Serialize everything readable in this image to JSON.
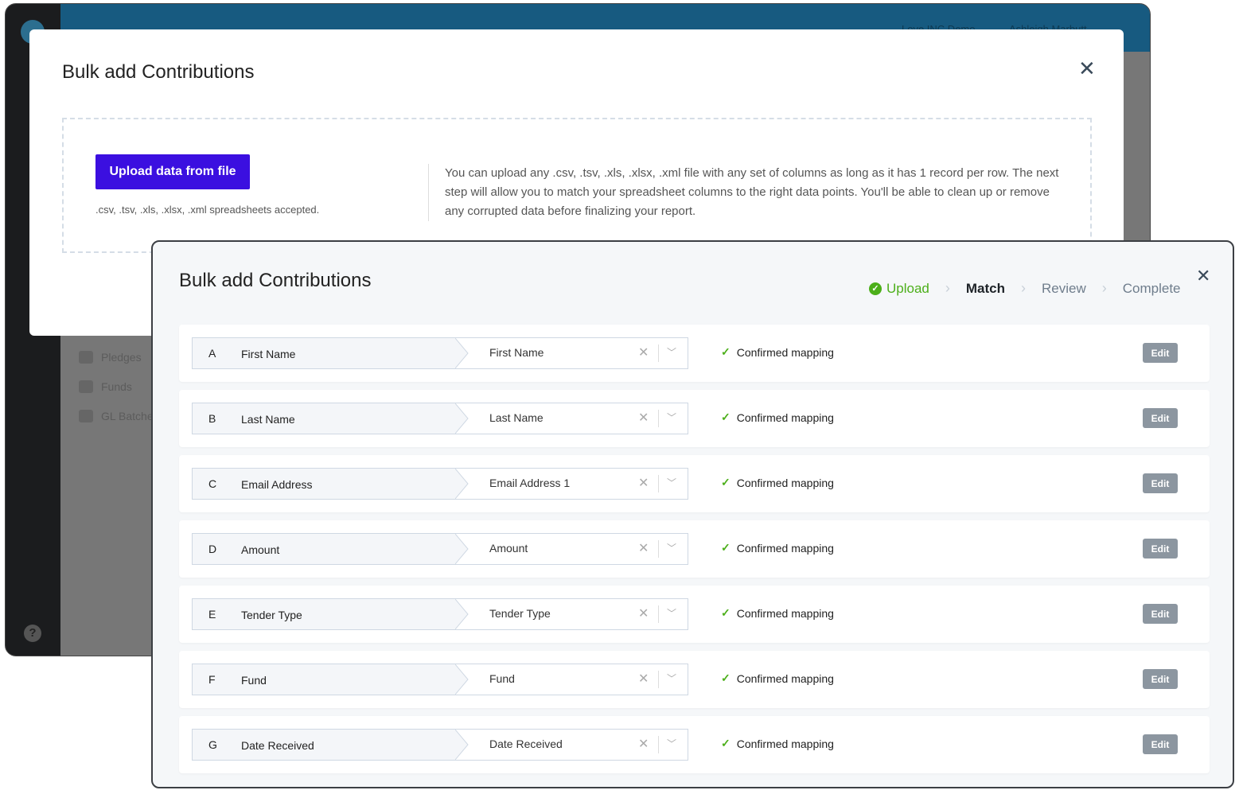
{
  "bg_app": {
    "org": "Love INC Demo",
    "user": "Ashleigh Marbutt",
    "nav": [
      {
        "label": "Pledges"
      },
      {
        "label": "Funds"
      },
      {
        "label": "GL Batches"
      }
    ],
    "help": "?"
  },
  "upload_modal": {
    "title": "Bulk add Contributions",
    "upload_button": "Upload data from file",
    "accepted": ".csv, .tsv, .xls, .xlsx, .xml spreadsheets accepted.",
    "description": "You can upload any .csv, .tsv, .xls, .xlsx, .xml file with any set of columns as long as it has 1 record per row. The next step will allow you to match your spreadsheet columns to the right data points. You'll be able to clean up or remove any corrupted data before finalizing your report."
  },
  "match_modal": {
    "title": "Bulk add Contributions",
    "steps": {
      "upload": "Upload",
      "match": "Match",
      "review": "Review",
      "complete": "Complete"
    },
    "rows": [
      {
        "letter": "A",
        "source": "First Name",
        "dest": "First Name",
        "status": "Confirmed mapping",
        "edit": "Edit"
      },
      {
        "letter": "B",
        "source": "Last Name",
        "dest": "Last Name",
        "status": "Confirmed mapping",
        "edit": "Edit"
      },
      {
        "letter": "C",
        "source": "Email Address",
        "dest": "Email Address 1",
        "status": "Confirmed mapping",
        "edit": "Edit"
      },
      {
        "letter": "D",
        "source": "Amount",
        "dest": "Amount",
        "status": "Confirmed mapping",
        "edit": "Edit"
      },
      {
        "letter": "E",
        "source": "Tender Type",
        "dest": "Tender Type",
        "status": "Confirmed mapping",
        "edit": "Edit"
      },
      {
        "letter": "F",
        "source": "Fund",
        "dest": "Fund",
        "status": "Confirmed mapping",
        "edit": "Edit"
      },
      {
        "letter": "G",
        "source": "Date Received",
        "dest": "Date Received",
        "status": "Confirmed mapping",
        "edit": "Edit"
      }
    ]
  },
  "colors": {
    "primary": "#3b0fe0",
    "header": "#175a80",
    "success": "#4caf1a"
  }
}
